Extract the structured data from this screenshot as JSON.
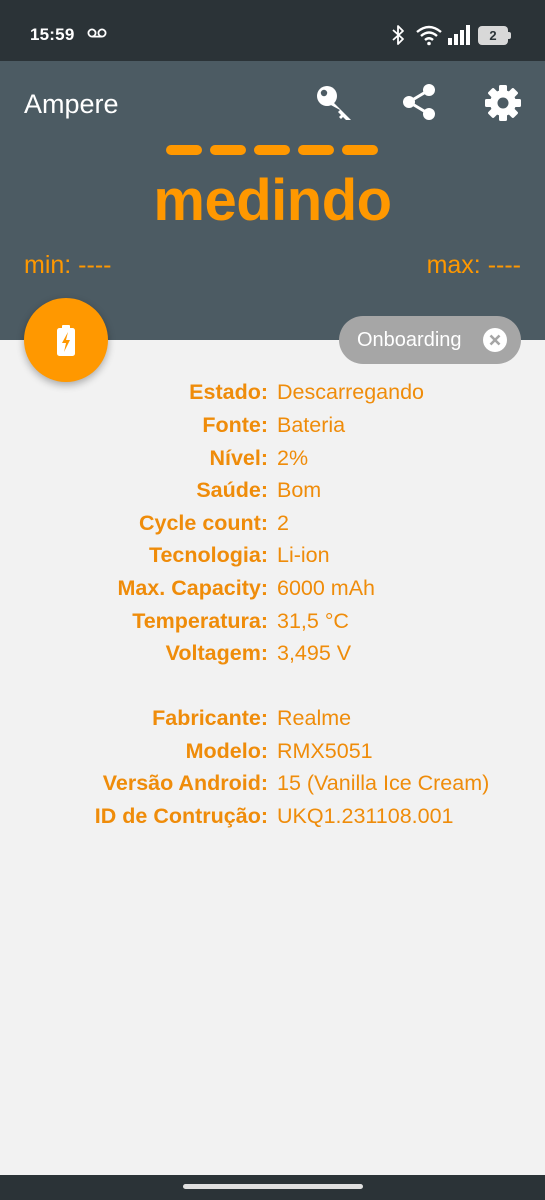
{
  "status_bar": {
    "time": "15:59",
    "battery_level": "2"
  },
  "header": {
    "app_title": "Ampere",
    "reading": "medindo",
    "min_label": "min: ----",
    "max_label": "max: ----",
    "accent_color": "#ff9800",
    "background_color": "#4c5b63"
  },
  "chip": {
    "label": "Onboarding"
  },
  "battery_info": [
    {
      "key": "Estado:",
      "value": "Descarregando"
    },
    {
      "key": "Fonte:",
      "value": "Bateria"
    },
    {
      "key": "Nível:",
      "value": "2%"
    },
    {
      "key": "Saúde:",
      "value": "Bom"
    },
    {
      "key": "Cycle count:",
      "value": "2"
    },
    {
      "key": "Tecnologia:",
      "value": "Li-ion"
    },
    {
      "key": "Max. Capacity:",
      "value": "6000 mAh"
    },
    {
      "key": "Temperatura:",
      "value": "31,5 °C"
    },
    {
      "key": "Voltagem:",
      "value": "3,495 V"
    }
  ],
  "device_info": [
    {
      "key": "Fabricante:",
      "value": "Realme"
    },
    {
      "key": "Modelo:",
      "value": "RMX5051"
    },
    {
      "key": "Versão Android:",
      "value": "15 (Vanilla Ice Cream)"
    },
    {
      "key": "ID de Contrução:",
      "value": "UKQ1.231108.001"
    }
  ],
  "icons": [
    "voicemail-icon",
    "bluetooth-icon",
    "wifi-icon",
    "signal-icon",
    "key-icon",
    "share-icon",
    "settings-icon",
    "battery-charging-icon",
    "close-icon"
  ]
}
